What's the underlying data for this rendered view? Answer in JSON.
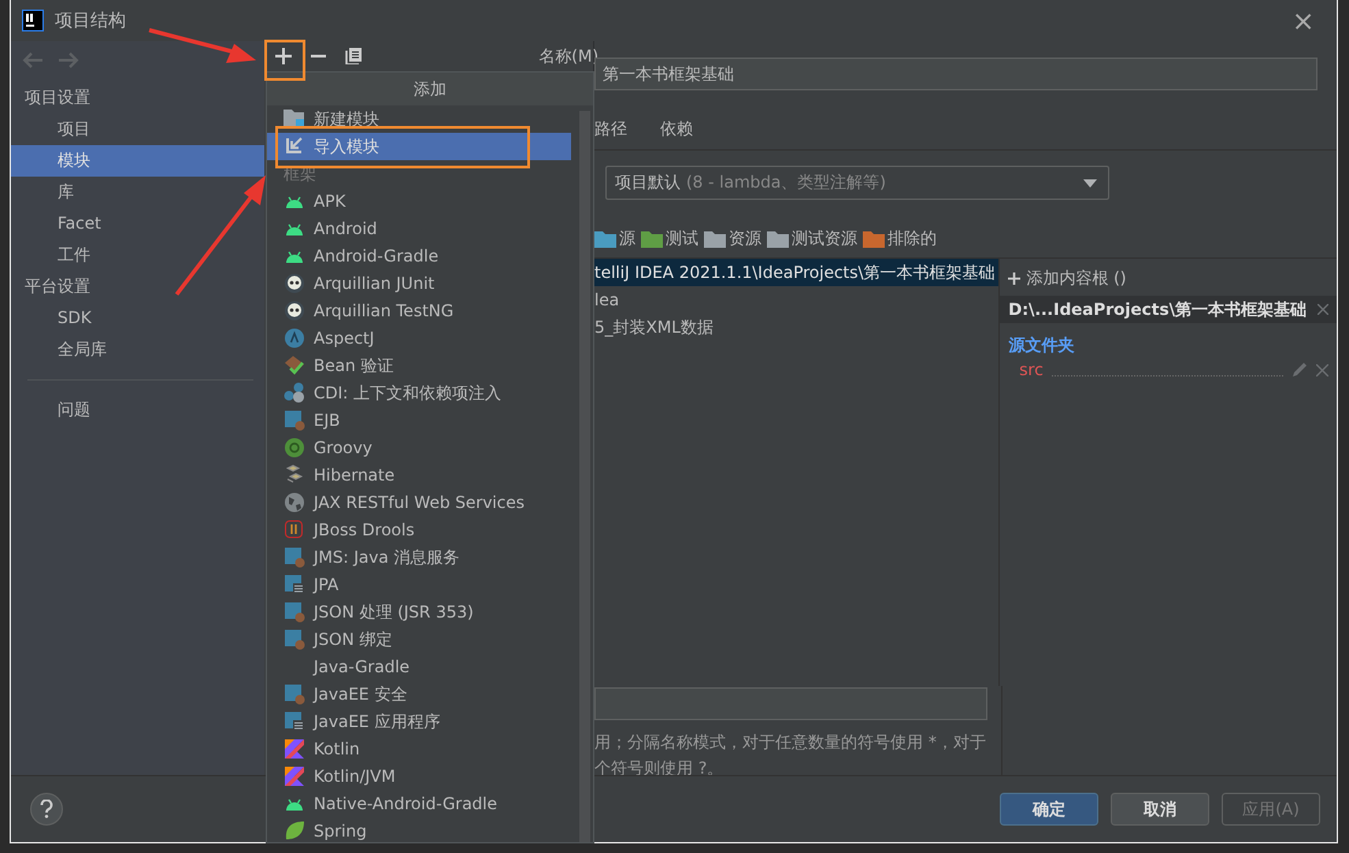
{
  "window": {
    "title": "项目结构",
    "close": "×"
  },
  "sidebar": {
    "items": [
      {
        "kind": "header",
        "label": "项目设置",
        "selected": false
      },
      {
        "kind": "item",
        "label": "项目",
        "selected": false
      },
      {
        "kind": "item",
        "label": "模块",
        "selected": true
      },
      {
        "kind": "item",
        "label": "库",
        "selected": false
      },
      {
        "kind": "item",
        "label": "Facet",
        "selected": false
      },
      {
        "kind": "item",
        "label": "工件",
        "selected": false
      },
      {
        "kind": "header",
        "label": "平台设置",
        "selected": false
      },
      {
        "kind": "item",
        "label": "SDK",
        "selected": false
      },
      {
        "kind": "item",
        "label": "全局库",
        "selected": false
      },
      {
        "kind": "divider"
      },
      {
        "kind": "item",
        "label": "问题",
        "selected": false
      }
    ]
  },
  "name_label": "名称(M)",
  "name_value": "第一本书框架基础",
  "tabs": [
    {
      "label": "路径"
    },
    {
      "label": "依赖"
    }
  ],
  "language_level": {
    "value": "项目默认",
    "detail": "(8 - lambda、类型注解等)"
  },
  "folder_kinds": [
    {
      "label": "源",
      "color": "#4a9cc0"
    },
    {
      "label": "测试",
      "color": "#5f9e45"
    },
    {
      "label": "资源",
      "color": "#9aa2a8"
    },
    {
      "label": "测试资源",
      "color": "#9aa2a8"
    },
    {
      "label": "排除的",
      "color": "#c8672e"
    }
  ],
  "tree": [
    {
      "label": "telliJ IDEA 2021.1.1\\IdeaProjects\\第一本书框架基础",
      "selected": true
    },
    {
      "label": "lea",
      "selected": false
    },
    {
      "label": "5_封装XML数据",
      "selected": false
    }
  ],
  "content_root": {
    "add": "添加内容根 ()",
    "path": "D:\\...IdeaProjects\\第一本书框架基础",
    "section": "源文件夹",
    "folders": [
      "src"
    ]
  },
  "exclude_hint": [
    "用；分隔名称模式，对于任意数量的符号使用 *，对于",
    "个符号则使用 ?。"
  ],
  "buttons": [
    {
      "label": "确定",
      "kind": "primary"
    },
    {
      "label": "取消",
      "kind": "normal"
    },
    {
      "label": "应用(A)",
      "kind": "disabled"
    }
  ],
  "popup": {
    "title": "添加",
    "items": [
      {
        "kind": "folder",
        "label": "新建模块",
        "selected": false
      },
      {
        "kind": "import",
        "label": "导入模块",
        "selected": true
      },
      {
        "kind": "header",
        "label": "框架"
      },
      {
        "kind": "android",
        "label": "APK",
        "selected": false
      },
      {
        "kind": "android",
        "label": "Android",
        "selected": false
      },
      {
        "kind": "android",
        "label": "Android-Gradle",
        "selected": false
      },
      {
        "kind": "skull",
        "label": "Arquillian JUnit",
        "selected": false
      },
      {
        "kind": "skull",
        "label": "Arquillian TestNG",
        "selected": false
      },
      {
        "kind": "aspect",
        "label": "AspectJ",
        "selected": false
      },
      {
        "kind": "bean",
        "label": "Bean 验证",
        "selected": false
      },
      {
        "kind": "cdi",
        "label": "CDI: 上下文和依赖项注入",
        "selected": false
      },
      {
        "kind": "javaee",
        "label": "EJB",
        "selected": false
      },
      {
        "kind": "groovy",
        "label": "Groovy",
        "selected": false
      },
      {
        "kind": "hibernate",
        "label": "Hibernate",
        "selected": false
      },
      {
        "kind": "globe",
        "label": "JAX RESTful Web Services",
        "selected": false
      },
      {
        "kind": "drools",
        "label": "JBoss Drools",
        "selected": false
      },
      {
        "kind": "javaee",
        "label": "JMS: Java 消息服务",
        "selected": false
      },
      {
        "kind": "jpa",
        "label": "JPA",
        "selected": false
      },
      {
        "kind": "javaee",
        "label": "JSON 处理 (JSR 353)",
        "selected": false
      },
      {
        "kind": "javaee",
        "label": "JSON 绑定",
        "selected": false
      },
      {
        "kind": "plain",
        "label": "Java-Gradle",
        "selected": false
      },
      {
        "kind": "javaee",
        "label": "JavaEE 安全",
        "selected": false
      },
      {
        "kind": "jpa",
        "label": "JavaEE 应用程序",
        "selected": false
      },
      {
        "kind": "kotlin",
        "label": "Kotlin",
        "selected": false
      },
      {
        "kind": "kotlin",
        "label": "Kotlin/JVM",
        "selected": false
      },
      {
        "kind": "android",
        "label": "Native-Android-Gradle",
        "selected": false
      },
      {
        "kind": "spring",
        "label": "Spring",
        "selected": false
      }
    ]
  }
}
